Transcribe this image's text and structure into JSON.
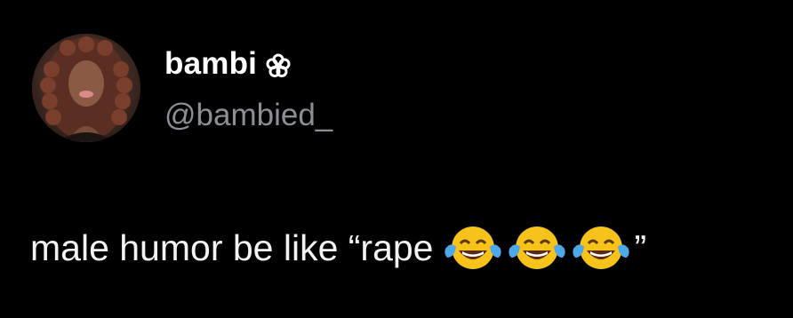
{
  "tweet": {
    "display_name": "bambi",
    "name_badge_icon": "flower-icon",
    "handle": "@bambied_",
    "text_before_emoji": "male humor be like “rape",
    "emojis": [
      "face-with-tears-of-joy-icon",
      "face-with-tears-of-joy-icon",
      "face-with-tears-of-joy-icon"
    ],
    "text_after_emoji": "”"
  },
  "colors": {
    "background": "#000000",
    "name": "#ffffff",
    "handle": "#8b9096",
    "text": "#f2f2f2",
    "emoji_face": "#f6c21c"
  }
}
